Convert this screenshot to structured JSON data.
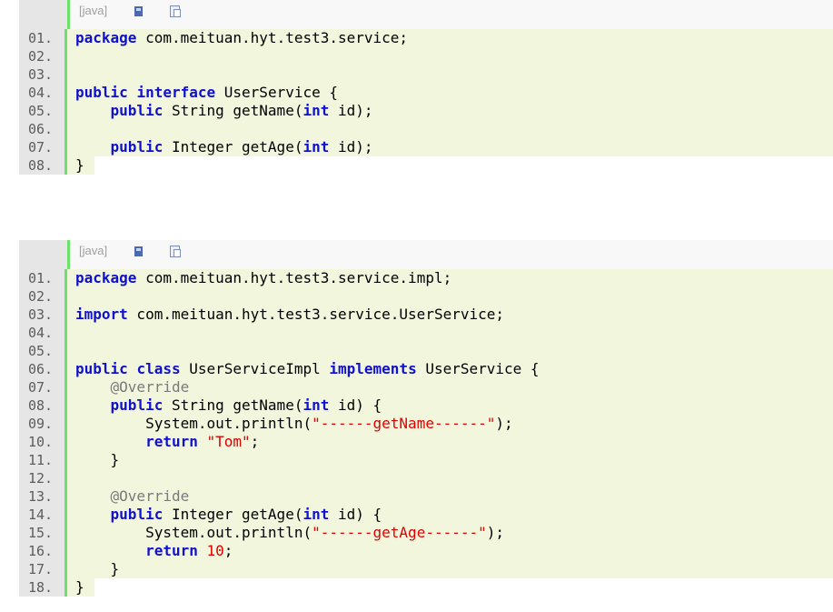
{
  "colors": {
    "keyword": "#1010d0",
    "string": "#e00000",
    "annotation": "#7a7a7a",
    "number": "#e00000",
    "plain": "#000000",
    "gutter_bg": "#e6e6e6",
    "gutter_border": "#6ce26c",
    "code_bg": "#f2f6dd"
  },
  "snippets": [
    {
      "lang_label": "[java]",
      "icons": [
        "view-source-icon",
        "copy-icon"
      ],
      "lines": [
        {
          "no": "01.",
          "tokens": [
            {
              "t": "package",
              "c": "keyword"
            },
            {
              "t": " com.meituan.hyt.test3.service;",
              "c": "plain"
            }
          ]
        },
        {
          "no": "02.",
          "tokens": []
        },
        {
          "no": "03.",
          "tokens": []
        },
        {
          "no": "04.",
          "tokens": [
            {
              "t": "public",
              "c": "keyword"
            },
            {
              "t": " ",
              "c": "plain"
            },
            {
              "t": "interface",
              "c": "keyword"
            },
            {
              "t": " UserService {",
              "c": "plain"
            }
          ]
        },
        {
          "no": "05.",
          "tokens": [
            {
              "t": "    ",
              "c": "plain"
            },
            {
              "t": "public",
              "c": "keyword"
            },
            {
              "t": " String getName(",
              "c": "plain"
            },
            {
              "t": "int",
              "c": "keyword"
            },
            {
              "t": " id);",
              "c": "plain"
            }
          ]
        },
        {
          "no": "06.",
          "tokens": []
        },
        {
          "no": "07.",
          "tokens": [
            {
              "t": "    ",
              "c": "plain"
            },
            {
              "t": "public",
              "c": "keyword"
            },
            {
              "t": " Integer getAge(",
              "c": "plain"
            },
            {
              "t": "int",
              "c": "keyword"
            },
            {
              "t": " id);",
              "c": "plain"
            }
          ]
        },
        {
          "no": "08.",
          "tokens": [
            {
              "t": "}",
              "c": "plain"
            }
          ]
        }
      ]
    },
    {
      "lang_label": "[java]",
      "icons": [
        "view-source-icon",
        "copy-icon"
      ],
      "lines": [
        {
          "no": "01.",
          "tokens": [
            {
              "t": "package",
              "c": "keyword"
            },
            {
              "t": " com.meituan.hyt.test3.service.impl;",
              "c": "plain"
            }
          ]
        },
        {
          "no": "02.",
          "tokens": []
        },
        {
          "no": "03.",
          "tokens": [
            {
              "t": "import",
              "c": "keyword"
            },
            {
              "t": " com.meituan.hyt.test3.service.UserService;",
              "c": "plain"
            }
          ]
        },
        {
          "no": "04.",
          "tokens": []
        },
        {
          "no": "05.",
          "tokens": []
        },
        {
          "no": "06.",
          "tokens": [
            {
              "t": "public",
              "c": "keyword"
            },
            {
              "t": " ",
              "c": "plain"
            },
            {
              "t": "class",
              "c": "keyword"
            },
            {
              "t": " UserServiceImpl ",
              "c": "plain"
            },
            {
              "t": "implements",
              "c": "keyword"
            },
            {
              "t": " UserService {",
              "c": "plain"
            }
          ]
        },
        {
          "no": "07.",
          "tokens": [
            {
              "t": "    ",
              "c": "plain"
            },
            {
              "t": "@Override",
              "c": "annotation"
            }
          ]
        },
        {
          "no": "08.",
          "tokens": [
            {
              "t": "    ",
              "c": "plain"
            },
            {
              "t": "public",
              "c": "keyword"
            },
            {
              "t": " String getName(",
              "c": "plain"
            },
            {
              "t": "int",
              "c": "keyword"
            },
            {
              "t": " id) {",
              "c": "plain"
            }
          ]
        },
        {
          "no": "09.",
          "tokens": [
            {
              "t": "        System.out.println(",
              "c": "plain"
            },
            {
              "t": "\"------getName------\"",
              "c": "string"
            },
            {
              "t": ");",
              "c": "plain"
            }
          ]
        },
        {
          "no": "10.",
          "tokens": [
            {
              "t": "        ",
              "c": "plain"
            },
            {
              "t": "return",
              "c": "keyword"
            },
            {
              "t": " ",
              "c": "plain"
            },
            {
              "t": "\"Tom\"",
              "c": "string"
            },
            {
              "t": ";",
              "c": "plain"
            }
          ]
        },
        {
          "no": "11.",
          "tokens": [
            {
              "t": "    }",
              "c": "plain"
            }
          ]
        },
        {
          "no": "12.",
          "tokens": []
        },
        {
          "no": "13.",
          "tokens": [
            {
              "t": "    ",
              "c": "plain"
            },
            {
              "t": "@Override",
              "c": "annotation"
            }
          ]
        },
        {
          "no": "14.",
          "tokens": [
            {
              "t": "    ",
              "c": "plain"
            },
            {
              "t": "public",
              "c": "keyword"
            },
            {
              "t": " Integer getAge(",
              "c": "plain"
            },
            {
              "t": "int",
              "c": "keyword"
            },
            {
              "t": " id) {",
              "c": "plain"
            }
          ]
        },
        {
          "no": "15.",
          "tokens": [
            {
              "t": "        System.out.println(",
              "c": "plain"
            },
            {
              "t": "\"------getAge------\"",
              "c": "string"
            },
            {
              "t": ");",
              "c": "plain"
            }
          ]
        },
        {
          "no": "16.",
          "tokens": [
            {
              "t": "        ",
              "c": "plain"
            },
            {
              "t": "return",
              "c": "keyword"
            },
            {
              "t": " ",
              "c": "plain"
            },
            {
              "t": "10",
              "c": "number"
            },
            {
              "t": ";",
              "c": "plain"
            }
          ]
        },
        {
          "no": "17.",
          "tokens": [
            {
              "t": "    }",
              "c": "plain"
            }
          ]
        },
        {
          "no": "18.",
          "tokens": [
            {
              "t": "}",
              "c": "plain"
            }
          ]
        }
      ]
    }
  ]
}
